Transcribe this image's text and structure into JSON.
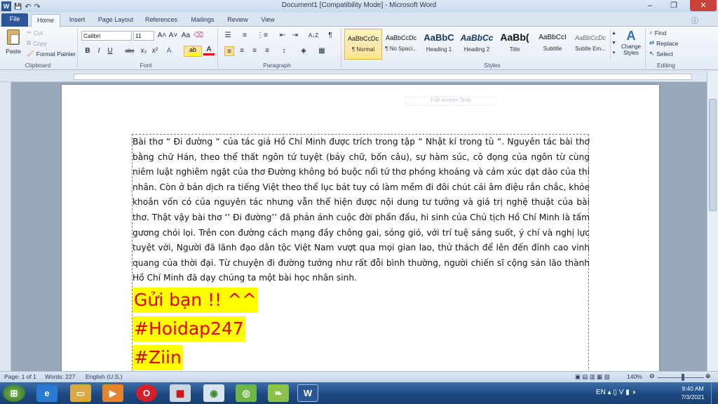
{
  "window": {
    "title": "Document1 [Compatibility Mode] - Microsoft Word",
    "quick_access": [
      "W",
      "💾",
      "↶",
      "↷"
    ],
    "controls": [
      "–",
      "❐",
      "✕"
    ]
  },
  "ribbon_tabs": [
    "File",
    "Home",
    "Insert",
    "Page Layout",
    "References",
    "Mailings",
    "Review",
    "View"
  ],
  "clipboard": {
    "paste": "Paste",
    "cut": "Cut",
    "copy": "Copy",
    "format_painter": "Format Painter",
    "label": "Clipboard"
  },
  "font": {
    "name": "Calibri",
    "size": "11",
    "buttons": [
      "B",
      "I",
      "U",
      "abc",
      "x₂",
      "x²",
      "A"
    ],
    "grow": "A˄",
    "shrink": "A˅",
    "case": "Aa",
    "clear": "⌫",
    "label": "Font"
  },
  "paragraph": {
    "label": "Paragraph",
    "pilcrow": "¶",
    "sort": "A↓Z"
  },
  "styles": {
    "label": "Styles",
    "items": [
      {
        "sample": "AaBbCcDc",
        "name": "¶ Normal"
      },
      {
        "sample": "AaBbCcDc",
        "name": "¶ No Spaci..."
      },
      {
        "sample": "AaBbC",
        "name": "Heading 1"
      },
      {
        "sample": "AaBbCc",
        "name": "Heading 2"
      },
      {
        "sample": "AaBb(",
        "name": "Title"
      },
      {
        "sample": "AaBbCcI",
        "name": "Subtitle"
      },
      {
        "sample": "AaBbCcDc",
        "name": "Subtle Em..."
      }
    ],
    "change_styles": "Change Styles"
  },
  "editing": {
    "find": "Find",
    "replace": "Replace",
    "select": "Select",
    "label": "Editing"
  },
  "document": {
    "snip_label": "Full-screen Snip",
    "paragraph": "Bài thơ “ Đi đường “ của tác giả Hồ Chí Minh được trích trong tập “ Nhật kí trong tù “. Nguyên tác bài thơ bằng chữ Hán, theo thể thất ngôn tứ tuyệt (bảy chữ, bốn câu), sự hàm súc, cô đọng của ngôn từ cùng niêm luật nghiêm ngặt của thơ Đường không bó buộc nổi tứ thơ phóng khoáng và cảm xúc dạt dào của thi nhân. Còn ở bản dịch ra tiếng Việt theo thể lục bát tuy có làm mềm đi đôi chút cái âm điệu rắn chắc, khỏe khoắn vốn có của nguyên tác nhưng vẫn thể hiện được nội dung tư tưởng và giá trị nghệ thuật của bài thơ. Thật vậy bài thơ ‘’ Đi đường’’ đã phản ánh cuộc đời phấn đấu, hi sinh của Chủ tịch Hồ Chí Minh là tấm gương chói lọi. Trên con đường cách mạng đầy chông gai, sóng gió, với trí tuệ sáng suốt, ý chí và nghị lực tuyệt vời, Người đã lãnh đạo dân tộc Việt Nam vượt qua mọi gian lao, thử thách để lên đến đỉnh cao vinh quang của thời đại. Từ chuyện đi đường tưởng như rất đỗi bình thường, người chiến sĩ cộng sản lão thành Hồ Chí Minh đã dạy chúng ta một bài học nhân sinh.",
    "highlights": [
      "Gửi bạn !! ^^",
      "#Hoidap247",
      "#Ziin"
    ],
    "highlight_color": "#ffff00",
    "highlight_text_color": "#e60000"
  },
  "status_bar": {
    "page": "Page: 1 of 1",
    "words": "Words: 227",
    "language": "English (U.S.)",
    "zoom": "140%"
  },
  "taskbar": {
    "time": "9:40 AM",
    "date": "7/3/2021"
  },
  "colors": {
    "file_tab": "#2b5797",
    "taskbar": "#1e4a82"
  }
}
